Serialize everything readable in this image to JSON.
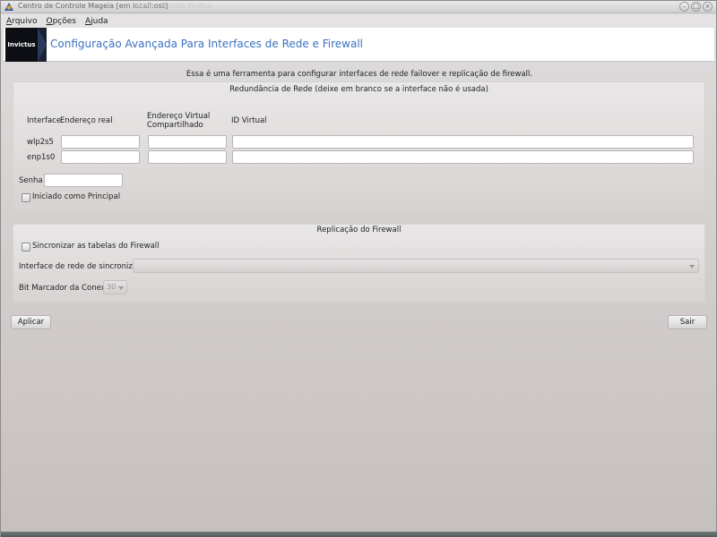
{
  "window": {
    "title": "Centro de Controle Mageia  [em localhost]",
    "ghost_title": "Novo - Mozilla Firefox",
    "controls": [
      "–",
      "□",
      "×"
    ]
  },
  "menubar": {
    "items": [
      {
        "first": "A",
        "rest": "rquivo"
      },
      {
        "first": "O",
        "rest": "pções"
      },
      {
        "first": "A",
        "rest": "juda"
      }
    ]
  },
  "banner": {
    "logo_text": "Invictus",
    "title": "Configuração Avançada Para Interfaces de Rede e Firewall"
  },
  "description": "Essa  é uma ferramenta para configurar interfaces de rede failover e replicação de firewall.",
  "redundancy": {
    "title": "Redundância de Rede (deixe em branco se a interface não é usada)",
    "headers": {
      "interface": "Interface",
      "real_address": "Endereço real",
      "virtual_line1": "Endereço Virtual",
      "virtual_line2": "Compartilhado",
      "virtual_id": "ID Virtual"
    },
    "rows": [
      {
        "iface": "wlp2s5",
        "real": "",
        "virtual": "",
        "id": ""
      },
      {
        "iface": "enp1s0",
        "real": "",
        "virtual": "",
        "id": ""
      }
    ],
    "password_label": "Senha",
    "password_value": "",
    "principal_label": "Iniciado como Principal"
  },
  "replication": {
    "title": "Replicação do Firewall",
    "sync_label": "Sincronizar as tabelas do Firewall",
    "sync_iface_label": "Interface de rede de sincronização",
    "sync_iface_value": "",
    "mark_bit_label": "Bit Marcador da Conexão",
    "mark_bit_value": "30"
  },
  "buttons": {
    "apply": "Aplicar",
    "quit": "Sair"
  },
  "colors": {
    "banner_title": "#3a72c0",
    "logo_bg": "#0d0f14"
  }
}
